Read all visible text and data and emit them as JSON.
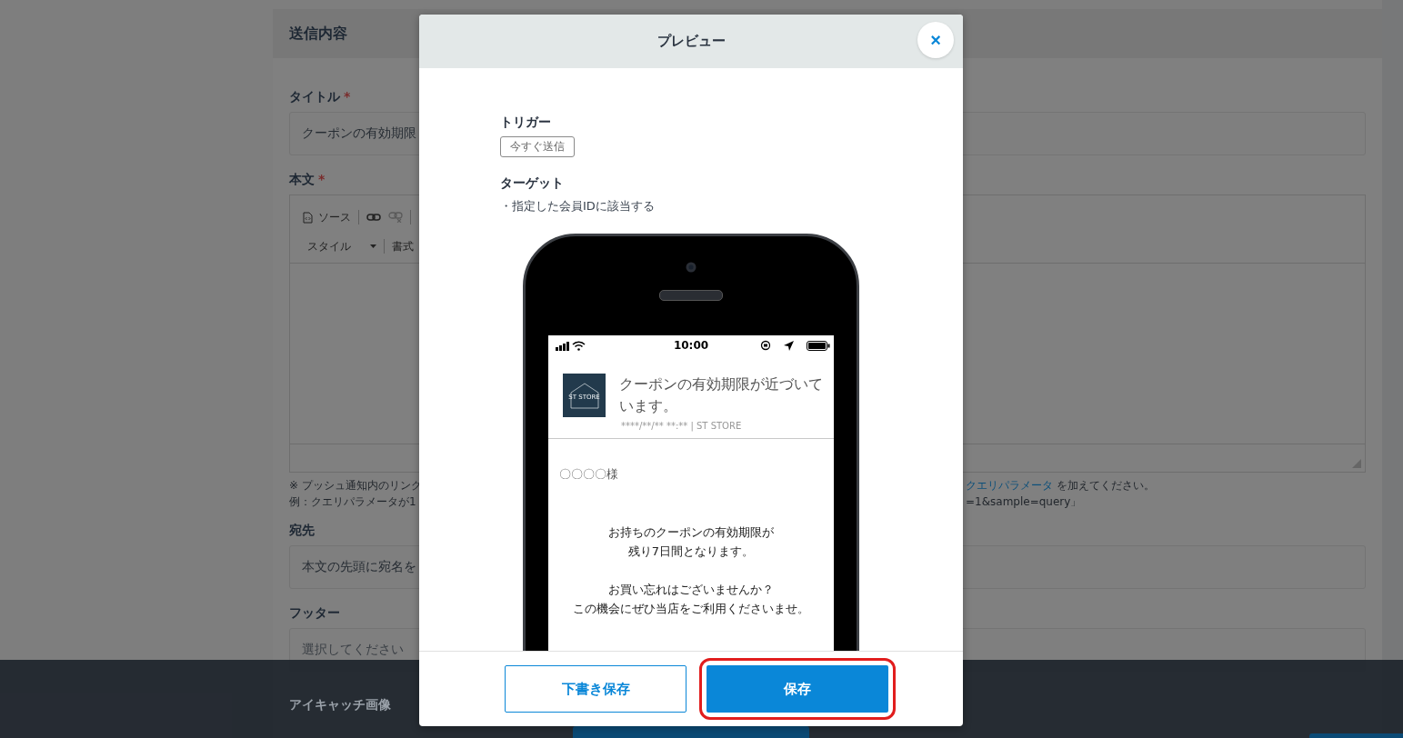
{
  "page": {
    "section_title": "送信内容",
    "fields": [
      {
        "kind": "input",
        "label": "タイトル",
        "required_mark": "*",
        "value": "クーポンの有効期限"
      },
      {
        "kind": "editor",
        "label": "本文",
        "required_mark": "*",
        "toolbar": [
          "ソース",
          "スタイル",
          "書式"
        ],
        "notes_left": [
          "※ プッシュ通知内のリンク",
          "例：クエリパラメータが1"
        ],
        "notes_right": [
          {
            "link": "クエリパラメータ",
            "text": "を加えてください。"
          },
          {
            "text": "=1&sample=query」"
          }
        ]
      },
      {
        "kind": "input",
        "label": "宛先",
        "value": "本文の先頭に宛名を"
      },
      {
        "kind": "select",
        "label": "フッター",
        "placeholder": "選択してください"
      },
      {
        "kind": "heading",
        "label": "アイキャッチ画像"
      }
    ]
  },
  "modal": {
    "title": "プレビュー",
    "close": "×",
    "trigger": {
      "label": "トリガー",
      "badge": "今すぐ送信"
    },
    "target": {
      "label": "ターゲット",
      "text": "・指定した会員IDに該当する"
    },
    "phone": {
      "time": "10:00",
      "logo_text": "ST STORE",
      "notification_title": "クーポンの有効期限が近づいています。",
      "meta": "****/**/** **:** | ST STORE",
      "greeting": "〇〇〇〇様",
      "paragraphs": [
        [
          "お持ちのクーポンの有効期限が",
          "残り7日間となります。"
        ],
        [
          "お買い忘れはございませんか？",
          "この機会にぜひ当店をご利用くださいませ。"
        ]
      ]
    },
    "buttons": [
      {
        "kind": "secondary",
        "label": "下書き保存"
      },
      {
        "kind": "primary",
        "label": "保存",
        "highlighted": true
      }
    ]
  }
}
